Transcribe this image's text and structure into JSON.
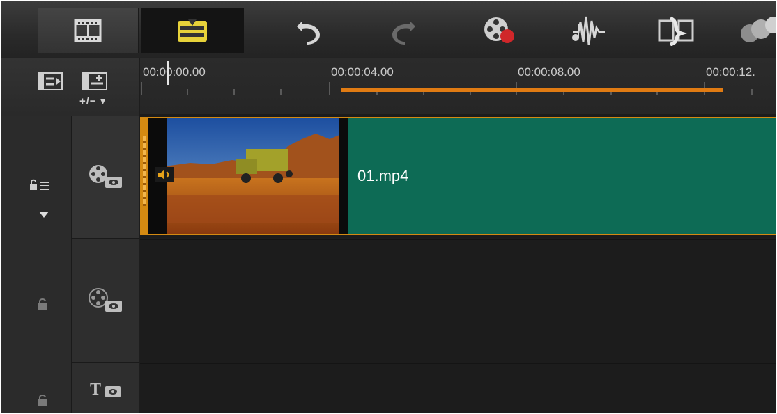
{
  "toolbar": {
    "buttons": [
      {
        "name": "storyboard-view",
        "icon": "film-icon"
      },
      {
        "name": "timeline-view",
        "icon": "timeline-icon",
        "active": true
      },
      {
        "name": "undo",
        "icon": "undo-icon"
      },
      {
        "name": "redo",
        "icon": "redo-icon",
        "disabled": true
      },
      {
        "name": "record-capture",
        "icon": "record-icon"
      },
      {
        "name": "auto-music",
        "icon": "music-icon"
      },
      {
        "name": "motion-tracking",
        "icon": "motion-icon"
      },
      {
        "name": "more",
        "icon": "spheres-icon"
      }
    ]
  },
  "track_controls": {
    "add_remove": "+/− ▾"
  },
  "ruler": {
    "labels": [
      "00:00:00.00",
      "00:00:04.00",
      "00:00:08.00",
      "00:00:12."
    ]
  },
  "clip": {
    "name": "01.mp4"
  },
  "colors": {
    "accent": "#e07b13",
    "clip_fill": "#0d6b55",
    "clip_border": "#d48a12",
    "timeline_icon": "#e7d23a"
  }
}
